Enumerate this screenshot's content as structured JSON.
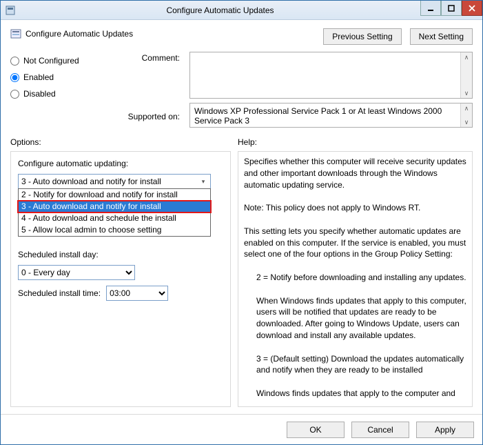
{
  "window": {
    "title": "Configure Automatic Updates"
  },
  "header": {
    "title": "Configure Automatic Updates",
    "prev": "Previous Setting",
    "next": "Next Setting"
  },
  "state": {
    "not_configured": "Not Configured",
    "enabled": "Enabled",
    "disabled": "Disabled",
    "selected": "enabled"
  },
  "labels": {
    "comment": "Comment:",
    "supported": "Supported on:",
    "options": "Options:",
    "help": "Help:"
  },
  "comment_value": "",
  "supported_value": "Windows XP Professional Service Pack 1 or At least Windows 2000 Service Pack 3",
  "options": {
    "configure_label": "Configure automatic updating:",
    "configure_selected": "3 - Auto download and notify for install",
    "configure_items": [
      "2 - Notify for download and notify for install",
      "3 - Auto download and notify for install",
      "4 - Auto download and schedule the install",
      "5 - Allow local admin to choose setting"
    ],
    "day_label": "Scheduled install day:",
    "day_value": "0 - Every day",
    "time_label": "Scheduled install time:",
    "time_value": "03:00"
  },
  "help": {
    "p1": "Specifies whether this computer will receive security updates and other important downloads through the Windows automatic updating service.",
    "p2": "Note: This policy does not apply to Windows RT.",
    "p3": "This setting lets you specify whether automatic updates are enabled on this computer. If the service is enabled, you must select one of the four options in the Group Policy Setting:",
    "p4": "2 = Notify before downloading and installing any updates.",
    "p5": "When Windows finds updates that apply to this computer, users will be notified that updates are ready to be downloaded. After going to Windows Update, users can download and install any available updates.",
    "p6": "3 = (Default setting) Download the updates automatically and notify when they are ready to be installed",
    "p7": "Windows finds updates that apply to the computer and"
  },
  "footer": {
    "ok": "OK",
    "cancel": "Cancel",
    "apply": "Apply"
  }
}
